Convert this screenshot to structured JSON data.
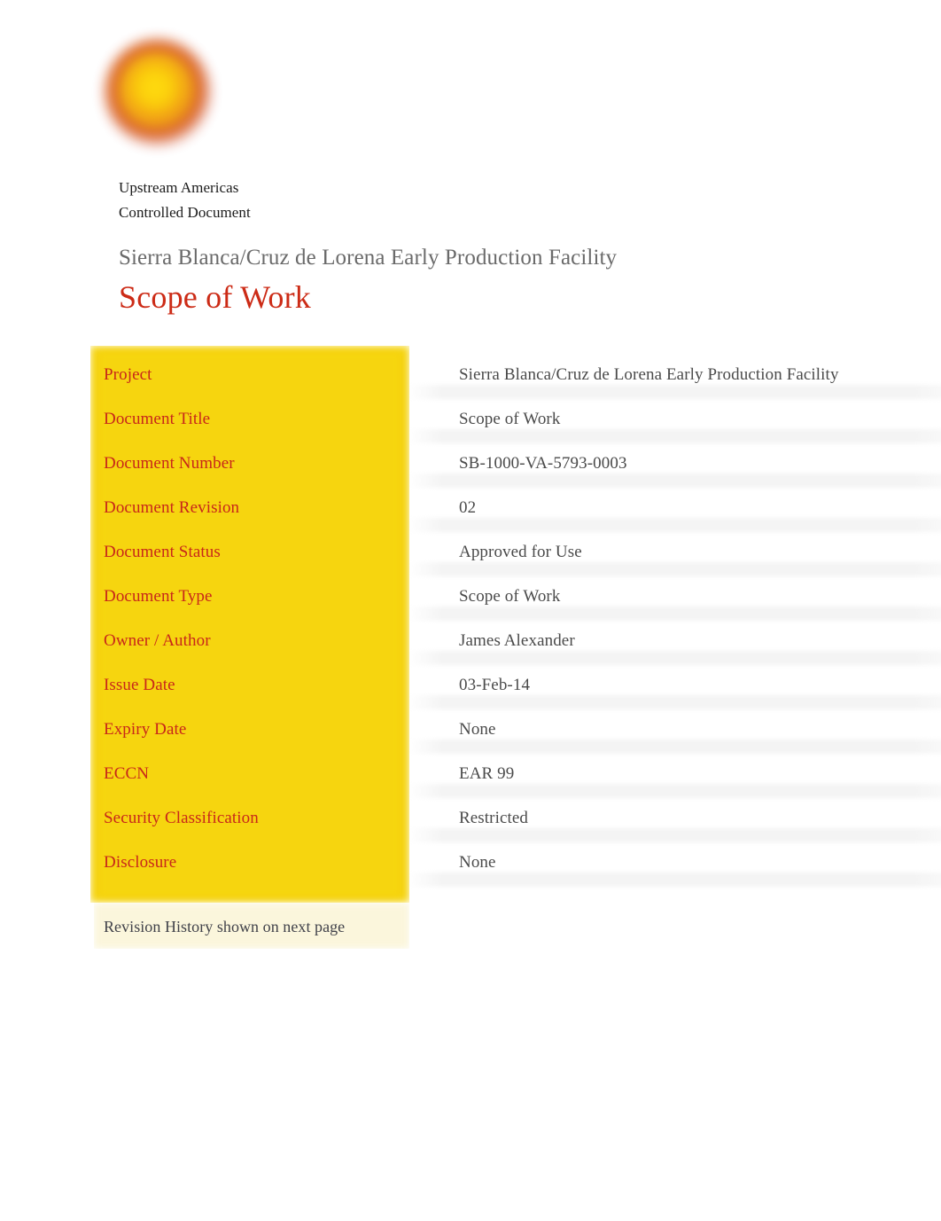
{
  "document": {
    "org_line_1": "Upstream Americas",
    "org_line_2": "Controlled Document",
    "project_subtitle": "Sierra Blanca/Cruz de Lorena Early Production Facility",
    "title": "Scope of Work"
  },
  "logo": {
    "name": "company-pecten-logo",
    "center_color": "#FFDD10",
    "mid_color": "#F3A814",
    "outer_color": "#D64E1C"
  },
  "colors": {
    "key_block_yellow": "#F6D50F",
    "key_label_red": "#C8271A",
    "title_red": "#CC2B16",
    "value_gray": "#4A4A4A",
    "subtitle_gray": "#6A6A6A",
    "note_strip_cream": "#FBF6DC",
    "stripe_gray": "#F2F2F2"
  },
  "metadata_table": {
    "rows": [
      {
        "label": "Project",
        "value": "Sierra Blanca/Cruz de Lorena Early Production Facility"
      },
      {
        "label": "Document Title",
        "value": "Scope of Work"
      },
      {
        "label": "Document Number",
        "value": "SB-1000-VA-5793-0003"
      },
      {
        "label": "Document Revision",
        "value": "02"
      },
      {
        "label": "Document Status",
        "value": "Approved for Use"
      },
      {
        "label": "Document Type",
        "value": "Scope of Work"
      },
      {
        "label": "Owner / Author",
        "value": "James Alexander"
      },
      {
        "label": "Issue Date",
        "value": "03-Feb-14"
      },
      {
        "label": "Expiry Date",
        "value": "None"
      },
      {
        "label": "ECCN",
        "value": "EAR 99"
      },
      {
        "label": "Security Classification",
        "value": "Restricted"
      },
      {
        "label": "Disclosure",
        "value": "None"
      }
    ],
    "footer_note": "Revision History shown on next page"
  }
}
